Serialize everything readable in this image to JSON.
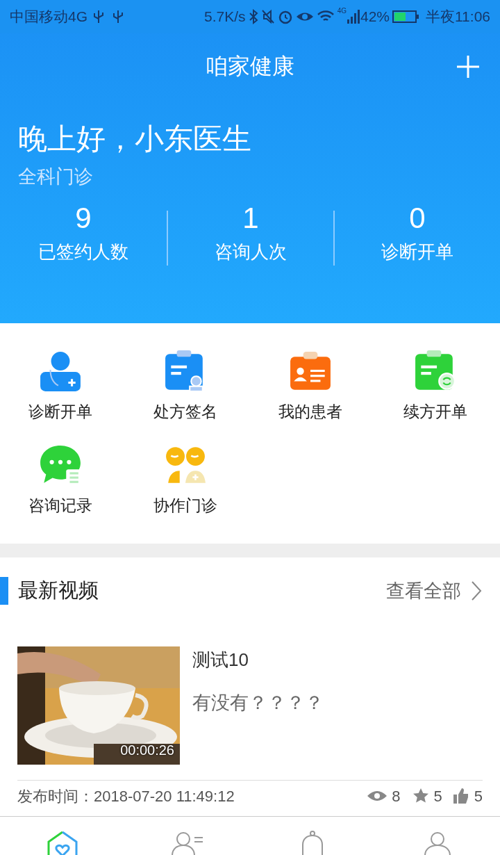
{
  "status_bar": {
    "carrier": "中国移动4G",
    "speed": "5.7K/s",
    "network": "4G",
    "battery": "42%",
    "time": "半夜11:06"
  },
  "header": {
    "title": "咱家健康",
    "greeting": "晚上好，小东医生",
    "department": "全科门诊",
    "stats": [
      {
        "value": "9",
        "label": "已签约人数"
      },
      {
        "value": "1",
        "label": "咨询人次"
      },
      {
        "value": "0",
        "label": "诊断开单"
      }
    ]
  },
  "shortcuts": [
    {
      "kind": "doctor",
      "label": "诊断开单"
    },
    {
      "kind": "prescription",
      "label": "处方签名"
    },
    {
      "kind": "patient",
      "label": "我的患者"
    },
    {
      "kind": "renewal",
      "label": "续方开单"
    },
    {
      "kind": "chat",
      "label": "咨询记录"
    },
    {
      "kind": "collab",
      "label": "协作门诊"
    }
  ],
  "videos_section": {
    "title": "最新视频",
    "more": "查看全部",
    "videos": [
      {
        "title": "测试10",
        "description": "有没有？？？？",
        "duration": "00:00:26",
        "published": "发布时间：2018-07-20 11:49:12",
        "views": "8",
        "favorites": "5",
        "likes": "5"
      }
    ]
  },
  "bottom_nav": [
    {
      "kind": "home",
      "selected": true
    },
    {
      "kind": "contacts",
      "selected": false
    },
    {
      "kind": "bell",
      "selected": false
    },
    {
      "kind": "profile",
      "selected": false
    }
  ]
}
